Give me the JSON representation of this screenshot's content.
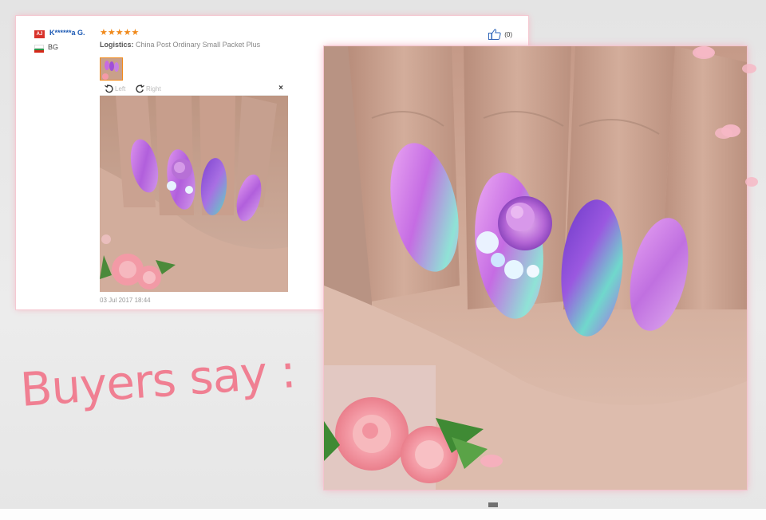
{
  "review": {
    "badge": "AJ",
    "reviewer": "K******a G.",
    "country": "BG",
    "stars": "★★★★★",
    "logistics_label": "Logistics:",
    "logistics_value": "China Post Ordinary Small Packet Plus",
    "helpful_count": "(0)",
    "rotate_left": "Left",
    "rotate_right": "Right",
    "close": "×",
    "date": "03 Jul 2017 18:44"
  },
  "headline": "Buyers say :",
  "icons": {
    "thumbs_up": "thumbs-up-icon",
    "rotate_left": "rotate-left-icon",
    "rotate_right": "rotate-right-icon",
    "close": "close-icon",
    "flag": "bulgaria-flag-icon"
  },
  "colors": {
    "accent_pink": "#f07f92",
    "star_orange": "#f08a1c",
    "name_blue": "#1b59b4",
    "nail_purple": "#b56be0"
  }
}
